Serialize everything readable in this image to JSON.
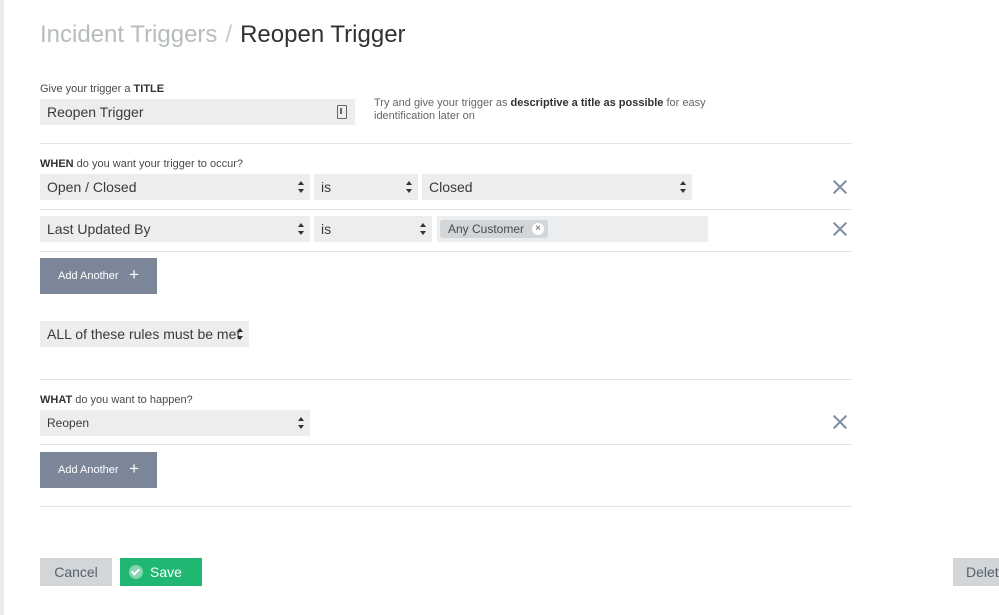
{
  "breadcrumb": {
    "parent": "Incident Triggers",
    "separator": "/",
    "current": "Reopen Trigger"
  },
  "title_section": {
    "label_prefix": "Give your trigger a",
    "label_bold": "TITLE",
    "value": "Reopen Trigger",
    "hint_prefix": "Try and give your trigger as",
    "hint_bold": "descriptive a title as possible",
    "hint_suffix": "for easy identification later on"
  },
  "when_section": {
    "label_bold": "WHEN",
    "label_rest": "do you want your trigger to occur?",
    "conditions": [
      {
        "field": "Open / Closed",
        "operator": "is",
        "value": "Closed"
      },
      {
        "field": "Last Updated By",
        "operator": "is",
        "tag": "Any Customer",
        "tag_remove": "×"
      }
    ],
    "add_label": "Add Another",
    "add_icon": "+",
    "match_mode": "ALL of these rules must be met"
  },
  "what_section": {
    "label_bold": "WHAT",
    "label_rest": "do you want to happen?",
    "actions": [
      {
        "action": "Reopen"
      }
    ],
    "add_label": "Add Another",
    "add_icon": "+"
  },
  "footer": {
    "cancel_label": "Cancel",
    "save_label": "Save",
    "delete_label": "Delete"
  },
  "icons": {
    "remove": "x-icon",
    "save": "check-circle-icon",
    "title_field": "text-edit-icon"
  },
  "colors": {
    "save": "#1fb772",
    "add_button": "#7b8799",
    "field_bg": "#ebedee",
    "remove_icon": "#7f8f9e"
  }
}
